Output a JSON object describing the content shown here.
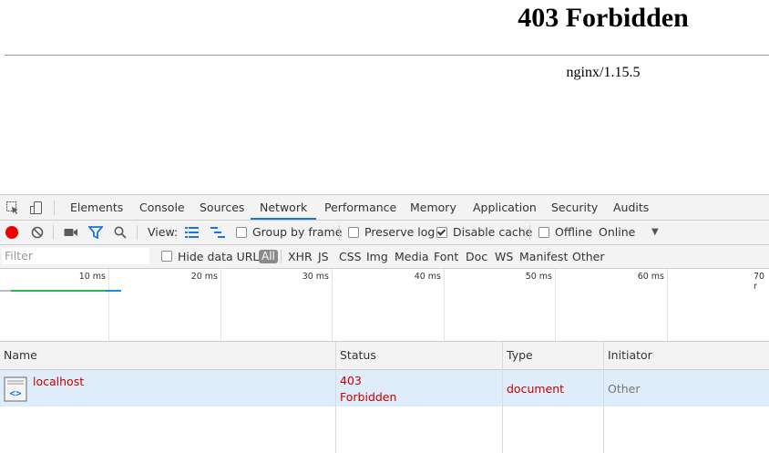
{
  "page": {
    "heading": "403 Forbidden",
    "server": "nginx/1.15.5"
  },
  "devtools": {
    "tabs": [
      {
        "label": "Elements"
      },
      {
        "label": "Console"
      },
      {
        "label": "Sources"
      },
      {
        "label": "Network",
        "active": true
      },
      {
        "label": "Performance"
      },
      {
        "label": "Memory"
      },
      {
        "label": "Application"
      },
      {
        "label": "Security"
      },
      {
        "label": "Audits"
      }
    ],
    "toolbar": {
      "view_label": "View:",
      "group_by_frame": "Group by frame",
      "preserve_log": "Preserve log",
      "disable_cache": "Disable cache",
      "offline": "Offline",
      "throttling": "Online"
    },
    "filter": {
      "placeholder": "Filter",
      "hide_data_urls": "Hide data URLs",
      "types": [
        "All",
        "XHR",
        "JS",
        "CSS",
        "Img",
        "Media",
        "Font",
        "Doc",
        "WS",
        "Manifest",
        "Other"
      ]
    },
    "timeline": {
      "ticks": [
        "10 ms",
        "20 ms",
        "30 ms",
        "40 ms",
        "50 ms",
        "60 ms",
        "70 r"
      ]
    },
    "table": {
      "headers": {
        "name": "Name",
        "status": "Status",
        "type": "Type",
        "initiator": "Initiator"
      },
      "rows": [
        {
          "name": "localhost",
          "status_code": "403",
          "status_text": "Forbidden",
          "type": "document",
          "initiator": "Other"
        }
      ]
    },
    "colors": {
      "error": "#c80000",
      "accent": "#1a73e8",
      "selected_row": "#dfecf9"
    }
  }
}
